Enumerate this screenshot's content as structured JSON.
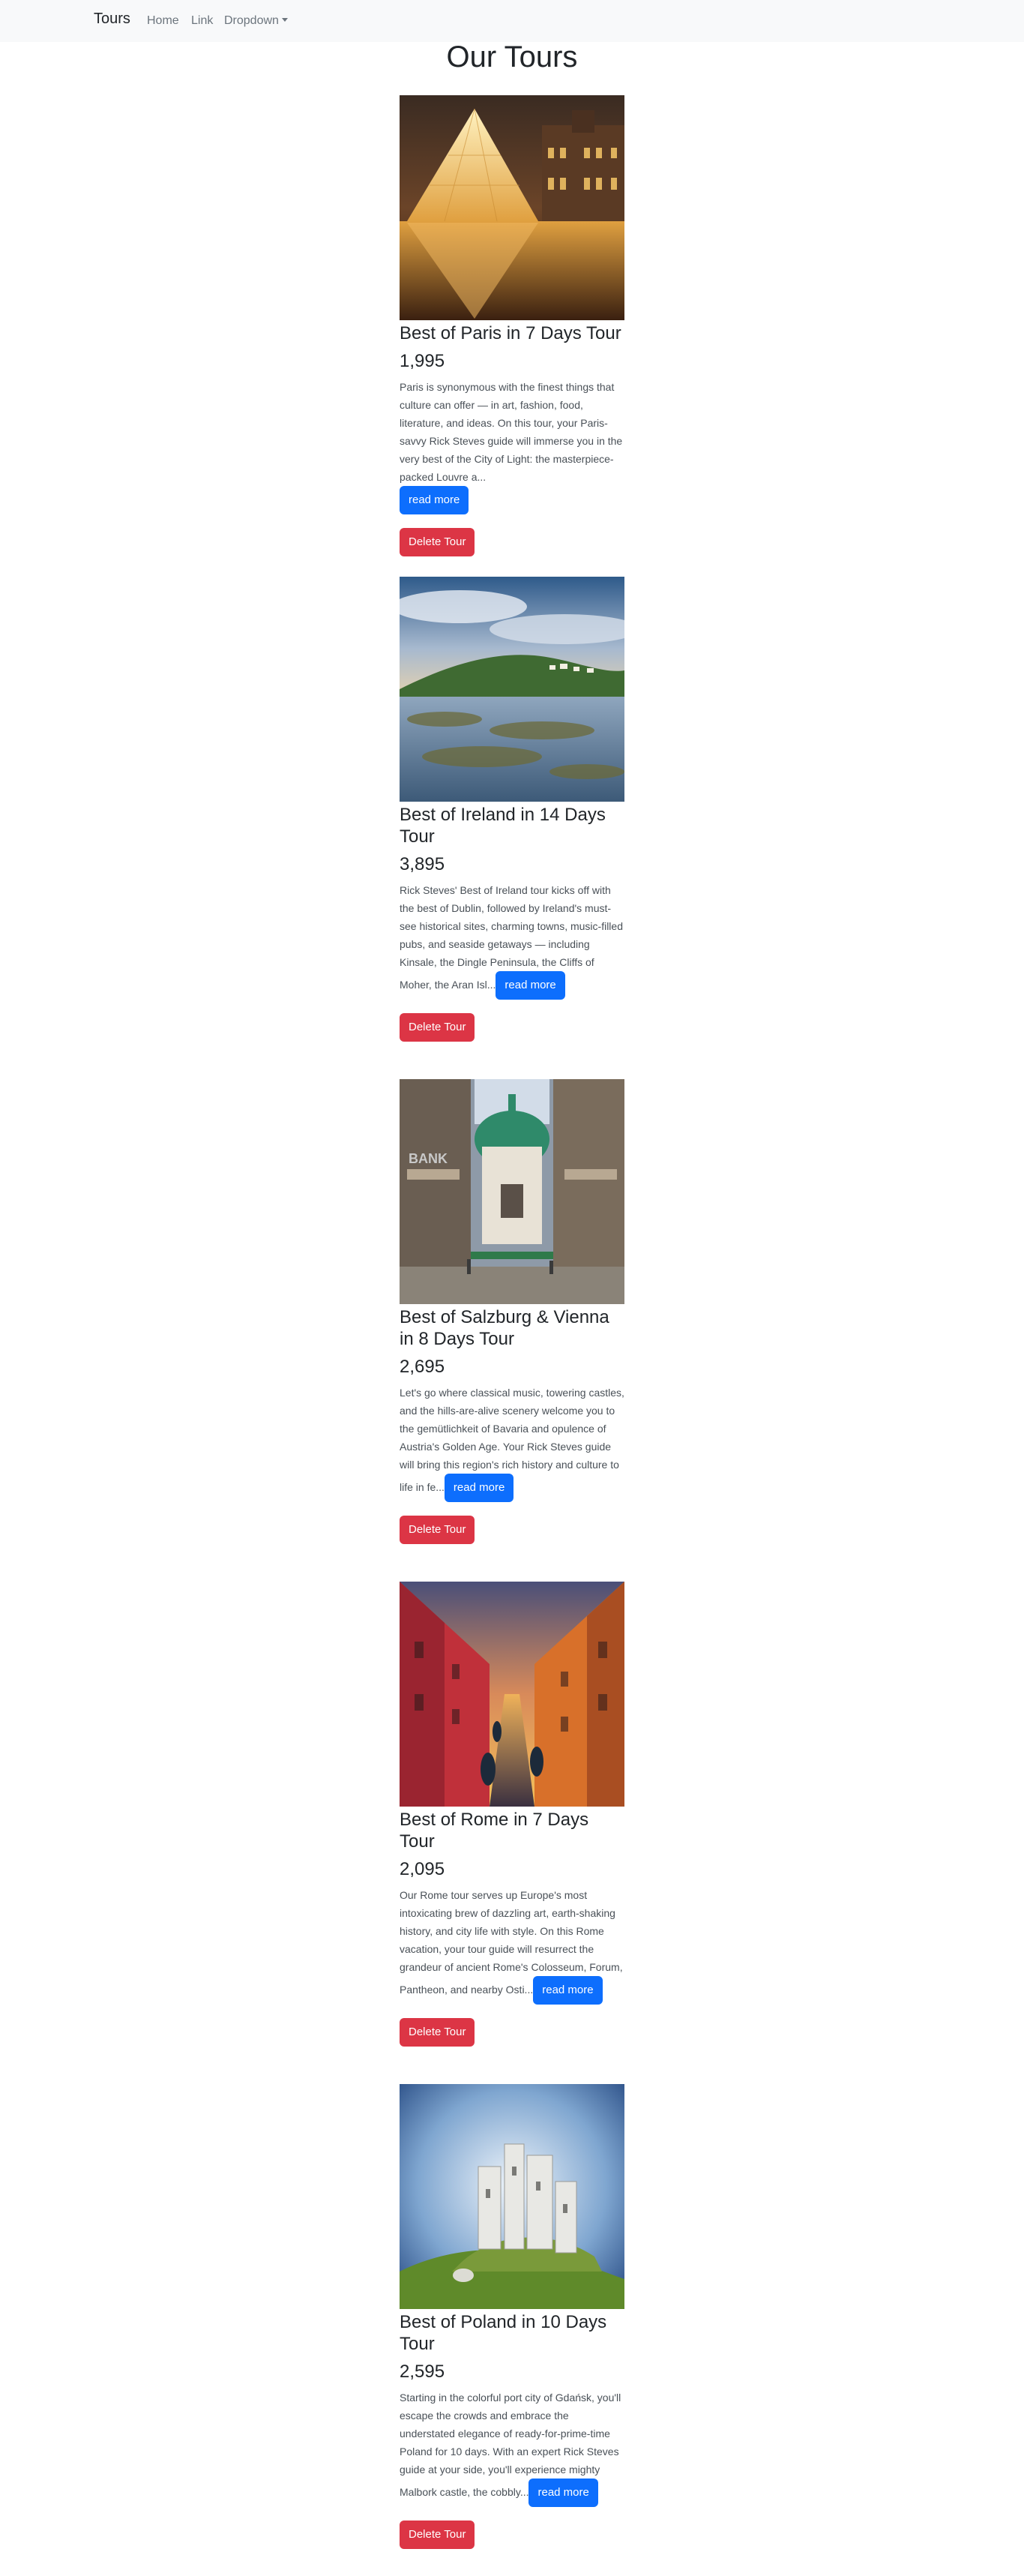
{
  "navbar": {
    "brand": "Tours",
    "links": [
      {
        "label": "Home"
      },
      {
        "label": "Link"
      },
      {
        "label": "Dropdown"
      }
    ]
  },
  "page_title": "Our Tours",
  "buttons": {
    "read_more": "read more",
    "delete": "Delete Tour"
  },
  "tours": [
    {
      "name": "Best of Paris in 7 Days Tour",
      "price": "1,995",
      "info": "Paris is synonymous with the finest things that culture can offer — in art, fashion, food, literature, and ideas. On this tour, your Paris-savvy Rick Steves guide will immerse you in the very best of the City of Light: the masterpiece-packed Louvre a...",
      "image": "louvre-pyramid-at-night"
    },
    {
      "name": "Best of Ireland in 14 Days Tour",
      "price": "3,895",
      "info": "Rick Steves' Best of Ireland tour kicks off with the best of Dublin, followed by Ireland's must-see historical sites, charming towns, music-filled pubs, and seaside getaways — including Kinsale, the Dingle Peninsula, the Cliffs of Moher, the Aran Isl...",
      "image": "irish-coastline-village"
    },
    {
      "name": "Best of Salzburg & Vienna in 8 Days Tour",
      "price": "2,695",
      "info": "Let's go where classical music, towering castles, and the hills-are-alive scenery welcome you to the gemütlichkeit of Bavaria and opulence of Austria's Golden Age. Your Rick Steves guide will bring this region's rich history and culture to life in fe...",
      "image": "vienna-church-street"
    },
    {
      "name": "Best of Rome in 7 Days Tour",
      "price": "2,095",
      "info": "Our Rome tour serves up Europe's most intoxicating brew of dazzling art, earth-shaking history, and city life with style. On this Rome vacation, your tour guide will resurrect the grandeur of ancient Rome's Colosseum, Forum, Pantheon, and nearby Osti...",
      "image": "canal-at-sunset"
    },
    {
      "name": "Best of Poland in 10 Days Tour",
      "price": "2,595",
      "info": "Starting in the colorful port city of Gdańsk, you'll escape the crowds and embrace the understated elegance of ready-for-prime-time Poland for 10 days. With an expert Rick Steves guide at your side, you'll experience mighty Malbork castle, the cobbly...",
      "image": "castle-ruins-on-hill"
    }
  ]
}
